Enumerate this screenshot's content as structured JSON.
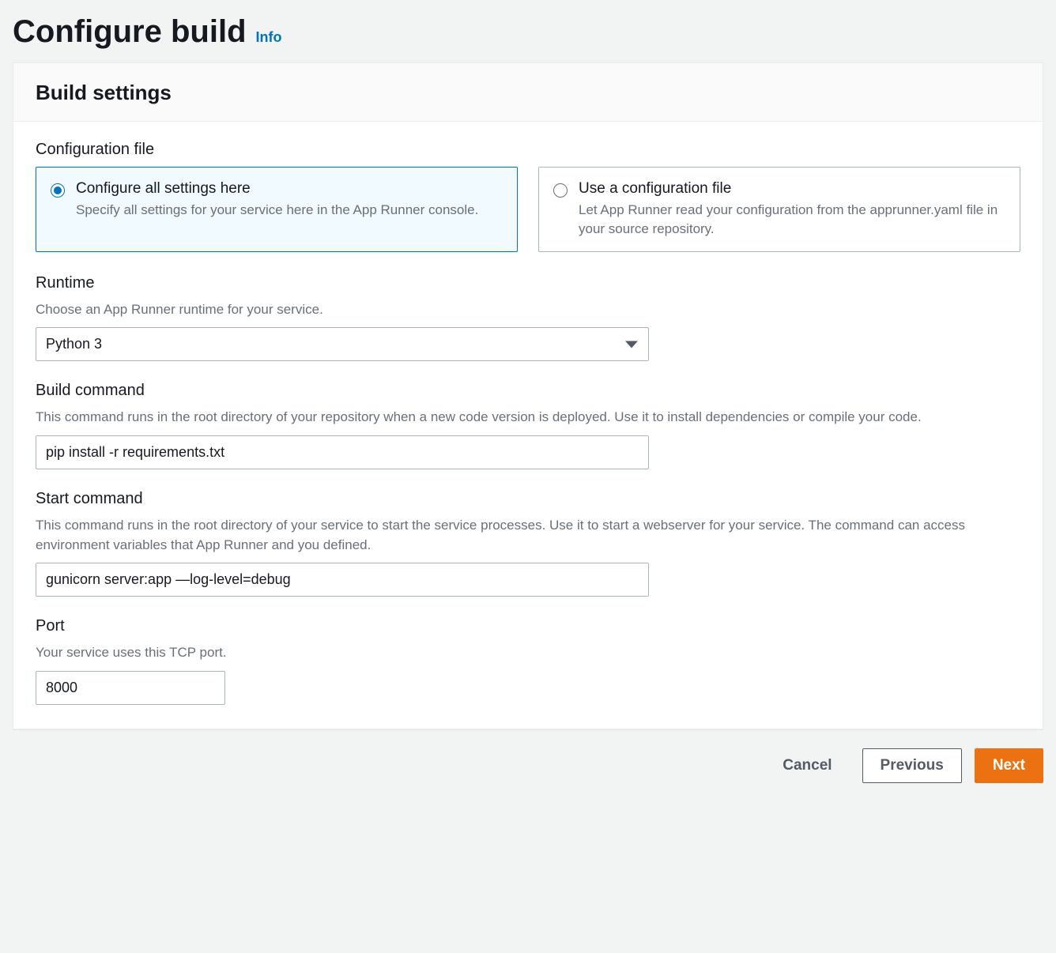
{
  "header": {
    "title": "Configure build",
    "info": "Info"
  },
  "panel": {
    "title": "Build settings"
  },
  "configFile": {
    "label": "Configuration file",
    "option1": {
      "title": "Configure all settings here",
      "desc": "Specify all settings for your service here in the App Runner console."
    },
    "option2": {
      "title": "Use a configuration file",
      "desc": "Let App Runner read your configuration from the apprunner.yaml file in your source repository."
    }
  },
  "runtime": {
    "label": "Runtime",
    "desc": "Choose an App Runner runtime for your service.",
    "value": "Python 3"
  },
  "buildCmd": {
    "label": "Build command",
    "desc": "This command runs in the root directory of your repository when a new code version is deployed. Use it to install dependencies or compile your code.",
    "value": "pip install -r requirements.txt"
  },
  "startCmd": {
    "label": "Start command",
    "desc": "This command runs in the root directory of your service to start the service processes. Use it to start a webserver for your service. The command can access environment variables that App Runner and you defined.",
    "value": "gunicorn server:app —log-level=debug"
  },
  "port": {
    "label": "Port",
    "desc": "Your service uses this TCP port.",
    "value": "8000"
  },
  "footer": {
    "cancel": "Cancel",
    "previous": "Previous",
    "next": "Next"
  }
}
